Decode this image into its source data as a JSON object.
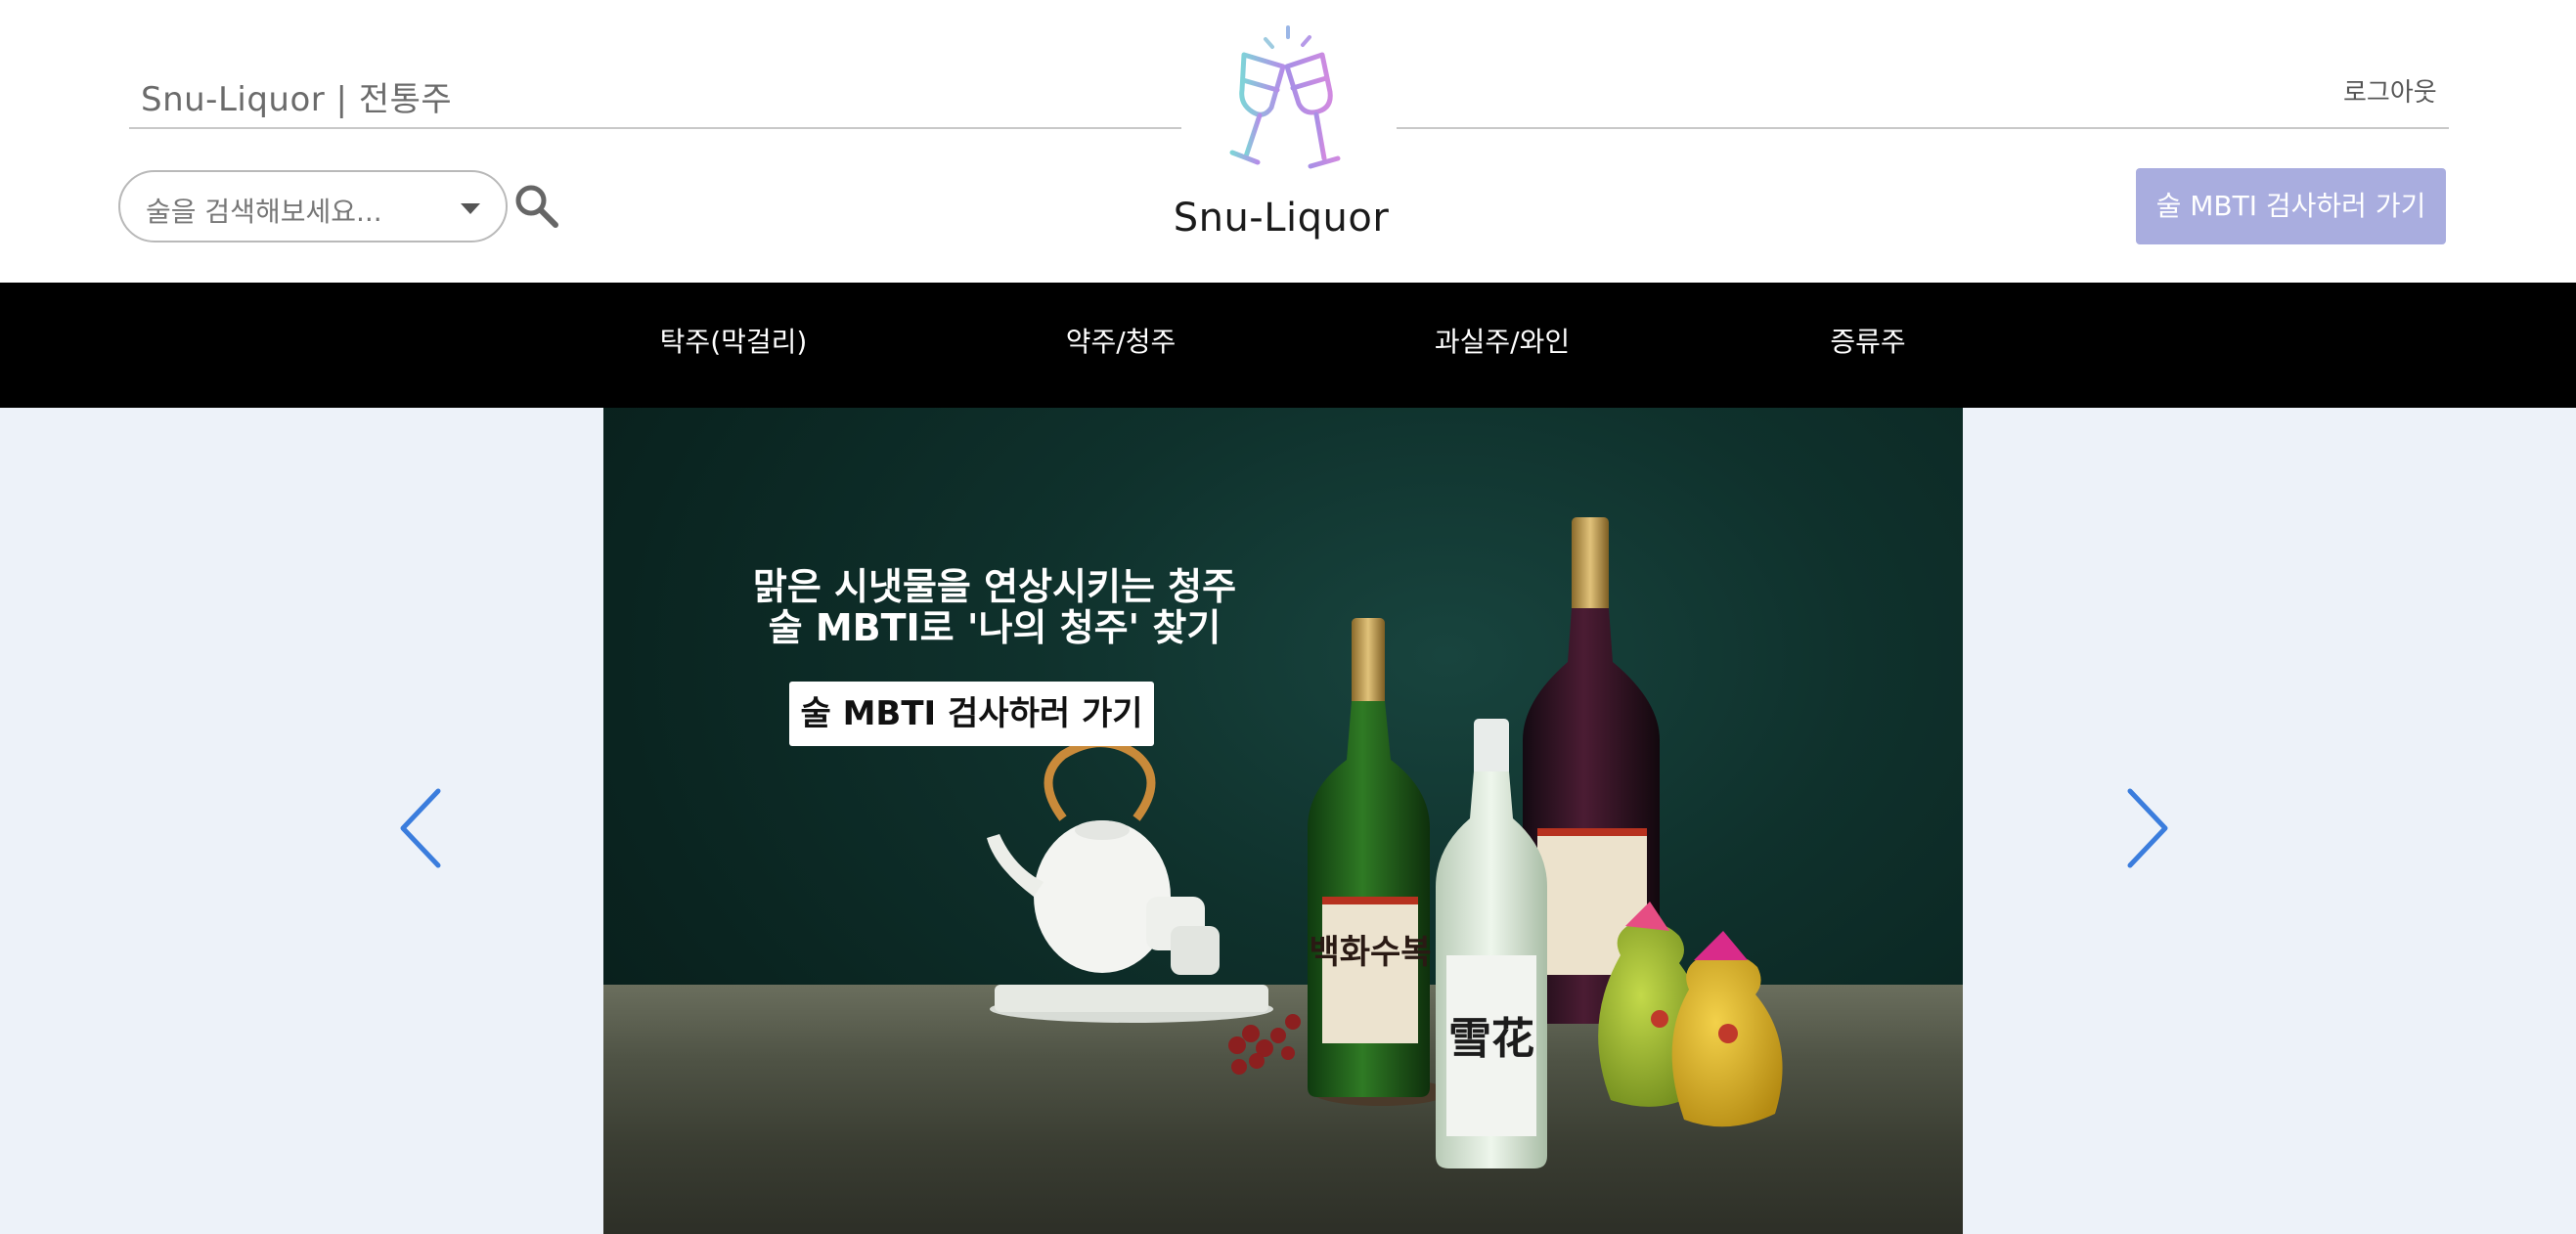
{
  "header": {
    "site_caption": "Snu-Liquor | 전통주",
    "logout_label": "로그아웃",
    "logo_text": "Snu-Liquor",
    "search": {
      "placeholder": "술을 검색해보세요..."
    },
    "mbti_button_label": "술 MBTI 검사하러 가기"
  },
  "nav": {
    "items": [
      {
        "label": "탁주(막걸리)"
      },
      {
        "label": "약주/청주"
      },
      {
        "label": "과실주/와인"
      },
      {
        "label": "증류주"
      }
    ]
  },
  "carousel": {
    "headline_line1": "맑은 시냇물을 연상시키는 청주",
    "headline_line2": "술 MBTI로 '나의 청주' 찾기",
    "cta_label": "술 MBTI 검사하러 가기",
    "label_text_main": "백화수복",
    "label_text_small": "雪花"
  },
  "colors": {
    "accent": "#a9addf",
    "nav_background": "#000000",
    "carousel_background": "#edf2f9",
    "arrow": "#3b7ddd"
  },
  "icons": {
    "search": "search-icon",
    "dropdown": "chevron-down-icon",
    "logo": "cheers-glasses-icon",
    "prev": "chevron-left-icon",
    "next": "chevron-right-icon"
  }
}
